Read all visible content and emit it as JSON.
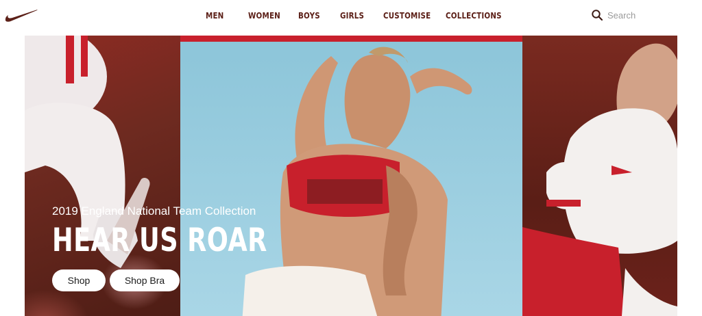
{
  "brand": {
    "logo": "swoosh-icon",
    "accent": "#5c2018"
  },
  "nav": {
    "items": [
      "MEN",
      "WOMEN",
      "BOYS",
      "GIRLS",
      "CUSTOMISE",
      "COLLECTIONS"
    ]
  },
  "search": {
    "placeholder": "Search",
    "icon": "search-icon"
  },
  "hero": {
    "eyebrow": "2019 England National Team Collection",
    "headline": "HEAR US ROAR",
    "buttons": [
      "Shop",
      "Shop Bra"
    ],
    "colors": {
      "red": "#c8202c",
      "sky": "#9fd0e2",
      "maroon": "#5b2419"
    }
  }
}
